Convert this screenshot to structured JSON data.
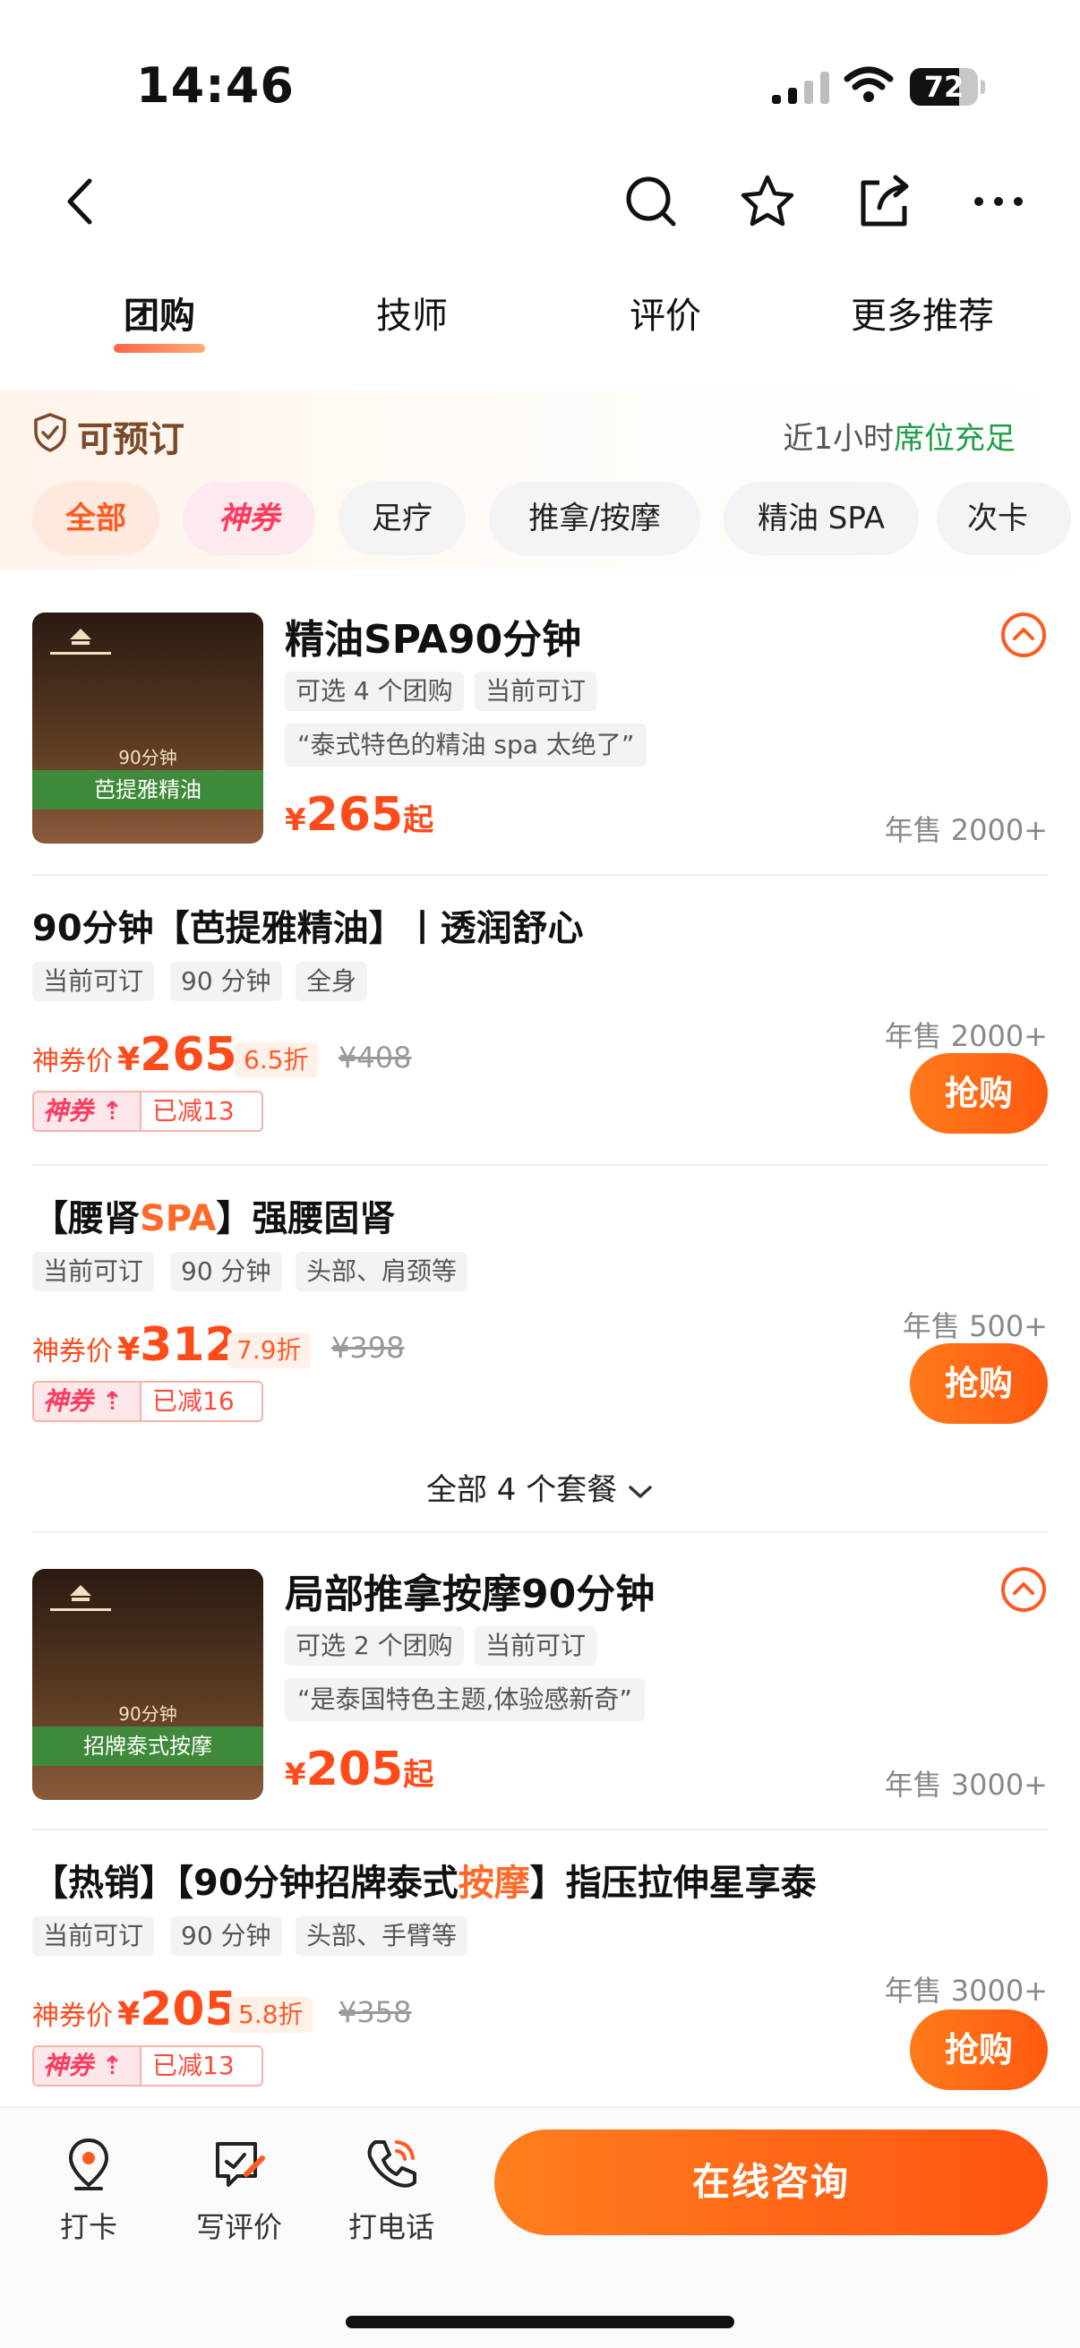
{
  "status_bar": {
    "time": "14:46",
    "battery": "72",
    "battery_level": 0.72
  },
  "nav": {
    "icons": [
      "back-icon",
      "search-icon",
      "star-icon",
      "share-icon",
      "more-icon"
    ]
  },
  "tabs": [
    {
      "label": "团购",
      "active": true
    },
    {
      "label": "技师",
      "active": false
    },
    {
      "label": "评价",
      "active": false
    },
    {
      "label": "更多推荐",
      "active": false
    }
  ],
  "booking": {
    "title": "可预订",
    "status_prefix": "近1小时",
    "status_highlight": "席位充足",
    "chips": [
      "全部",
      "神券",
      "足疗",
      "推拿/按摩",
      "精油 SPA",
      "次卡"
    ]
  },
  "groups": [
    {
      "thumb_text": "芭提雅精油",
      "thumb_sub": "90分钟",
      "title": "精油SPA90分钟",
      "tags": [
        "可选 4 个团购",
        "当前可订"
      ],
      "quote": "“泰式特色的精油 spa 太绝了”",
      "price_currency": "¥",
      "price": "265",
      "price_suffix": "起",
      "sales": "年售 2000+"
    },
    {
      "thumb_text": "招牌泰式按摩",
      "thumb_sub": "90分钟",
      "title": "局部推拿按摩90分钟",
      "tags": [
        "可选 2 个团购",
        "当前可订"
      ],
      "quote": "“是泰国特色主题,体验感新奇”",
      "price_currency": "¥",
      "price": "205",
      "price_suffix": "起",
      "sales": "年售 3000+"
    }
  ],
  "deals": [
    {
      "title_parts": [
        "90分钟【芭提雅精油】丨透润舒心",
        "",
        ""
      ],
      "tags": [
        "当前可订",
        "90 分钟",
        "全身"
      ],
      "price_label": "神券价",
      "currency": "¥",
      "price": "265",
      "discount": "6.5折",
      "original": "¥408",
      "coupon": "神券",
      "coupon_saving": "已减13 >",
      "sales": "年售 2000+",
      "buy": "抢购"
    },
    {
      "title_parts": [
        "【腰肾",
        "SPA",
        "】强腰固肾"
      ],
      "tags": [
        "当前可订",
        "90 分钟",
        "头部、肩颈等"
      ],
      "price_label": "神券价",
      "currency": "¥",
      "price": "312",
      "discount": "7.9折",
      "original": "¥398",
      "coupon": "神券",
      "coupon_saving": "已减16 >",
      "sales": "年售 500+",
      "buy": "抢购"
    },
    {
      "title_parts": [
        "【热销】【90分钟招牌泰式",
        "按摩",
        "】指压拉伸星享泰"
      ],
      "tags": [
        "当前可订",
        "90 分钟",
        "头部、手臂等"
      ],
      "price_label": "神券价",
      "currency": "¥",
      "price": "205",
      "discount": "5.8折",
      "original": "¥358",
      "coupon": "神券",
      "coupon_saving": "已减13 >",
      "sales": "年售 3000+",
      "buy": "抢购"
    }
  ],
  "all_packages": "全部 4 个套餐",
  "bottom_bar": {
    "items": [
      {
        "label": "打卡",
        "icon": "location-pin-icon"
      },
      {
        "label": "写评价",
        "icon": "write-review-icon"
      },
      {
        "label": "打电话",
        "icon": "phone-icon"
      }
    ],
    "consult": "在线咨询"
  },
  "colors": {
    "accent": "#ff5a10",
    "price": "#ff4a1a",
    "green": "#1f9e4a"
  }
}
